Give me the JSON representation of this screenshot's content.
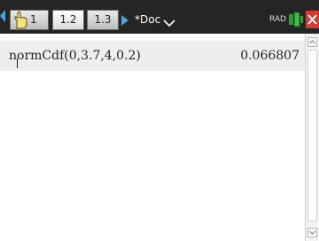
{
  "header": {
    "tabs": [
      {
        "label": "1"
      },
      {
        "label": "1.2"
      },
      {
        "label": "1.3"
      }
    ],
    "doc_title": "*Doc",
    "mode": "RAD"
  },
  "calculator": {
    "expression": "normCdf(0,3.7,4,0.2)",
    "result": "0.066807"
  },
  "colors": {
    "topbar": "#252525",
    "close": "#d33c2f",
    "row_highlight": "#eeeeee"
  }
}
